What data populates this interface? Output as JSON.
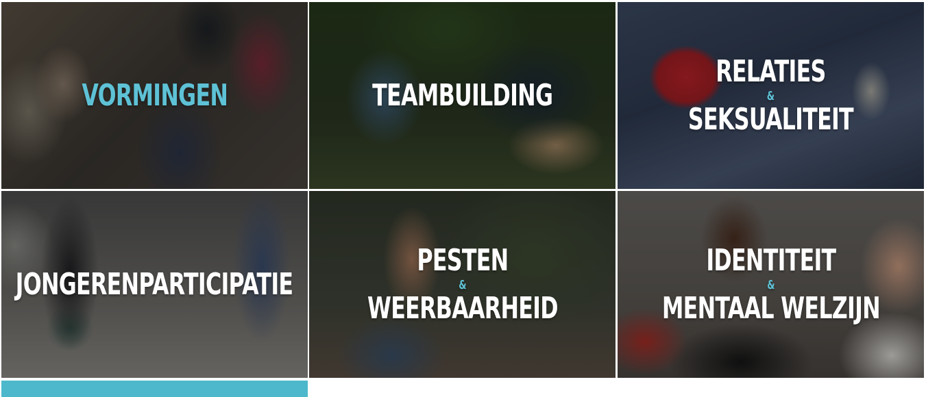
{
  "colors": {
    "accent": "#5ec2d6",
    "accent_bar": "#4db8cc",
    "label_white": "#ffffff"
  },
  "tiles": [
    {
      "title": "VORMINGEN"
    },
    {
      "title": "TEAMBUILDING"
    },
    {
      "line1": "RELATIES",
      "amp": "&",
      "line2": "SEKSUALITEIT"
    },
    {
      "title": "JONGERENPARTICIPATIE"
    },
    {
      "line1": "PESTEN",
      "amp": "&",
      "line2": "WEERBAARHEID"
    },
    {
      "line1": "IDENTITEIT",
      "amp": "&",
      "line2": "MENTAAL WELZIJN"
    }
  ]
}
